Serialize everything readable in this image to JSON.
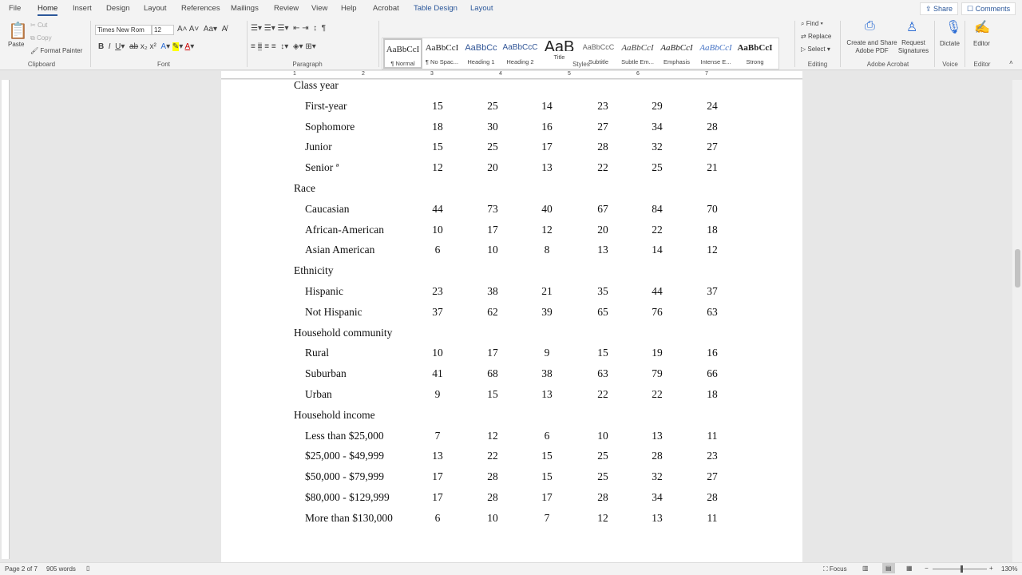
{
  "tabs": [
    "File",
    "Home",
    "Insert",
    "Design",
    "Layout",
    "References",
    "Mailings",
    "Review",
    "View",
    "Help",
    "Acrobat",
    "Table Design",
    "Layout"
  ],
  "top_buttons": {
    "share": "Share",
    "comments": "Comments"
  },
  "clipboard": {
    "paste": "Paste",
    "cut": "Cut",
    "copy": "Copy",
    "format_painter": "Format Painter",
    "label": "Clipboard"
  },
  "font": {
    "name": "Times New Rom",
    "size": "12",
    "label": "Font"
  },
  "paragraph": {
    "label": "Paragraph"
  },
  "styles": {
    "label": "Styles",
    "items": [
      {
        "preview": "AaBbCcI",
        "name": "¶ Normal"
      },
      {
        "preview": "AaBbCcI",
        "name": "¶ No Spac..."
      },
      {
        "preview": "AaBbCc",
        "name": "Heading 1"
      },
      {
        "preview": "AaBbCcC",
        "name": "Heading 2"
      },
      {
        "preview": "AaB",
        "name": "Title"
      },
      {
        "preview": "AaBbCcC",
        "name": "Subtitle"
      },
      {
        "preview": "AaBbCcI",
        "name": "Subtle Em..."
      },
      {
        "preview": "AaBbCcI",
        "name": "Emphasis"
      },
      {
        "preview": "AaBbCcI",
        "name": "Intense E..."
      },
      {
        "preview": "AaBbCcI",
        "name": "Strong"
      }
    ]
  },
  "editing": {
    "find": "Find",
    "replace": "Replace",
    "select": "Select",
    "label": "Editing"
  },
  "acrobat": {
    "create": "Create and Share Adobe PDF",
    "request": "Request Signatures",
    "label": "Adobe Acrobat"
  },
  "voice": {
    "dictate": "Dictate",
    "label": "Voice"
  },
  "editor": {
    "editor": "Editor",
    "label": "Editor"
  },
  "table": [
    {
      "label": "Class year",
      "header": true
    },
    {
      "label": "First-year",
      "values": [
        15,
        25,
        14,
        23,
        29,
        24
      ]
    },
    {
      "label": "Sophomore",
      "values": [
        18,
        30,
        16,
        27,
        34,
        28
      ]
    },
    {
      "label": "Junior",
      "values": [
        15,
        25,
        17,
        28,
        32,
        27
      ]
    },
    {
      "label": "Senior ª",
      "values": [
        12,
        20,
        13,
        22,
        25,
        21
      ]
    },
    {
      "label": "Race",
      "header": true
    },
    {
      "label": "Caucasian",
      "values": [
        44,
        73,
        40,
        67,
        84,
        70
      ]
    },
    {
      "label": "African-American",
      "values": [
        10,
        17,
        12,
        20,
        22,
        18
      ]
    },
    {
      "label": "Asian American",
      "values": [
        6,
        10,
        8,
        13,
        14,
        12
      ]
    },
    {
      "label": "Ethnicity",
      "header": true
    },
    {
      "label": "Hispanic",
      "values": [
        23,
        38,
        21,
        35,
        44,
        37
      ]
    },
    {
      "label": "Not Hispanic",
      "values": [
        37,
        62,
        39,
        65,
        76,
        63
      ]
    },
    {
      "label": "Household community",
      "header": true
    },
    {
      "label": "Rural",
      "values": [
        10,
        17,
        9,
        15,
        19,
        16
      ]
    },
    {
      "label": "Suburban",
      "values": [
        41,
        68,
        38,
        63,
        79,
        66
      ]
    },
    {
      "label": "Urban",
      "values": [
        9,
        15,
        13,
        22,
        22,
        18
      ]
    },
    {
      "label": "Household income",
      "header": true
    },
    {
      "label": "Less than $25,000",
      "values": [
        7,
        12,
        6,
        10,
        13,
        11
      ]
    },
    {
      "label": "$25,000 - $49,999",
      "values": [
        13,
        22,
        15,
        25,
        28,
        23
      ]
    },
    {
      "label": "$50,000 - $79,999",
      "values": [
        17,
        28,
        15,
        25,
        32,
        27
      ]
    },
    {
      "label": "$80,000 - $129,999",
      "values": [
        17,
        28,
        17,
        28,
        34,
        28
      ]
    },
    {
      "label": "More than $130,000",
      "values": [
        6,
        10,
        7,
        12,
        13,
        11
      ]
    }
  ],
  "status": {
    "page": "Page 2 of 7",
    "words": "905 words",
    "focus": "Focus",
    "zoom": "130%"
  }
}
